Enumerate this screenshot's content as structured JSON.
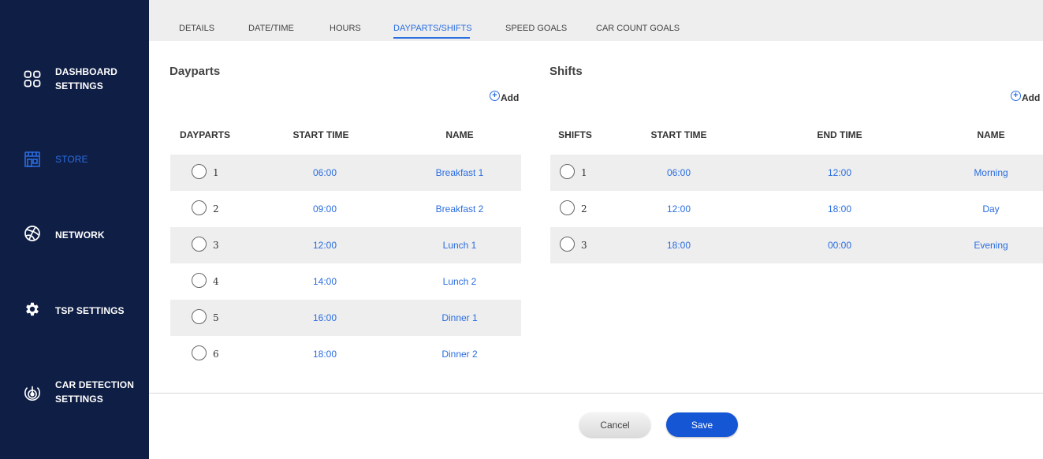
{
  "sidebar": {
    "items": [
      {
        "label_line1": "DASHBOARD",
        "label_line2": "SETTINGS",
        "icon": "dashboard-grid-icon",
        "active": false
      },
      {
        "label_line1": "STORE",
        "label_line2": "",
        "icon": "store-icon",
        "active": true
      },
      {
        "label_line1": "NETWORK",
        "label_line2": "",
        "icon": "network-globe-icon",
        "active": false
      },
      {
        "label_line1": "TSP SETTINGS",
        "label_line2": "",
        "icon": "gear-icon",
        "active": false
      },
      {
        "label_line1": "CAR DETECTION",
        "label_line2": "SETTINGS",
        "icon": "car-detection-icon",
        "active": false
      }
    ]
  },
  "tabs": [
    {
      "label": "DETAILS",
      "active": false
    },
    {
      "label": "DATE/TIME",
      "active": false
    },
    {
      "label": "HOURS",
      "active": false
    },
    {
      "label": "DAYPARTS/SHIFTS",
      "active": true
    },
    {
      "label": "SPEED GOALS",
      "active": false
    },
    {
      "label": "CAR COUNT GOALS",
      "active": false
    }
  ],
  "dayparts": {
    "title": "Dayparts",
    "add_label": "Add",
    "columns": [
      "DAYPARTS",
      "START TIME",
      "NAME"
    ],
    "rows": [
      {
        "num": "1",
        "start": "06:00",
        "name": "Breakfast 1"
      },
      {
        "num": "2",
        "start": "09:00",
        "name": "Breakfast 2"
      },
      {
        "num": "3",
        "start": "12:00",
        "name": "Lunch 1"
      },
      {
        "num": "4",
        "start": "14:00",
        "name": "Lunch 2"
      },
      {
        "num": "5",
        "start": "16:00",
        "name": "Dinner 1"
      },
      {
        "num": "6",
        "start": "18:00",
        "name": "Dinner 2"
      }
    ]
  },
  "shifts": {
    "title": "Shifts",
    "add_label": "Add",
    "columns": [
      "SHIFTS",
      "START TIME",
      "END TIME",
      "NAME"
    ],
    "rows": [
      {
        "num": "1",
        "start": "06:00",
        "end": "12:00",
        "name": "Morning"
      },
      {
        "num": "2",
        "start": "12:00",
        "end": "18:00",
        "name": "Day"
      },
      {
        "num": "3",
        "start": "18:00",
        "end": "00:00",
        "name": "Evening"
      }
    ]
  },
  "footer": {
    "cancel_label": "Cancel",
    "save_label": "Save"
  },
  "colors": {
    "sidebar_bg": "#0f1e45",
    "accent": "#2a6de0",
    "save_button": "#1556d4"
  }
}
